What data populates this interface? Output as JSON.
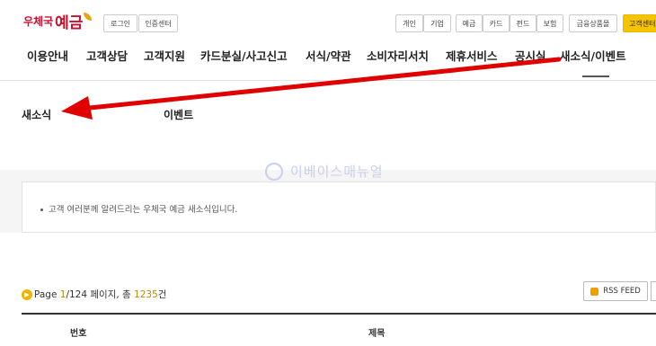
{
  "header": {
    "logo_small": "우체국",
    "logo_big": "예금",
    "util_links": [
      "로그인",
      "인증센터"
    ],
    "user_tabs": [
      "개인",
      "기업"
    ],
    "product_tabs": [
      "예금",
      "카드",
      "펀드",
      "보험"
    ],
    "shop_button": "금융상품몰",
    "center_button": "고객센터"
  },
  "nav": {
    "items": [
      "이용안내",
      "고객상담",
      "고객지원",
      "카드분실/사고신고",
      "서식/약관",
      "소비자리서치",
      "제휴서비스",
      "공시실",
      "새소식/이벤트"
    ],
    "active_index": 8
  },
  "subtabs": [
    "새소식",
    "이벤트"
  ],
  "notice": {
    "text": "고객 여러분께 알려드리는 우체국 예금 새소식입니다."
  },
  "watermark": "이베이스매뉴얼",
  "pagination": {
    "label": "Page",
    "current": "1",
    "total": "124",
    "pages_word": "페이지, 총",
    "count": "1235",
    "count_unit": "건"
  },
  "rss": {
    "label": "RSS FEED"
  },
  "table": {
    "headers": [
      "번호",
      "제목"
    ]
  },
  "colors": {
    "brand": "#c8102e",
    "accent": "#f0b400",
    "annotation": "#e00000"
  }
}
